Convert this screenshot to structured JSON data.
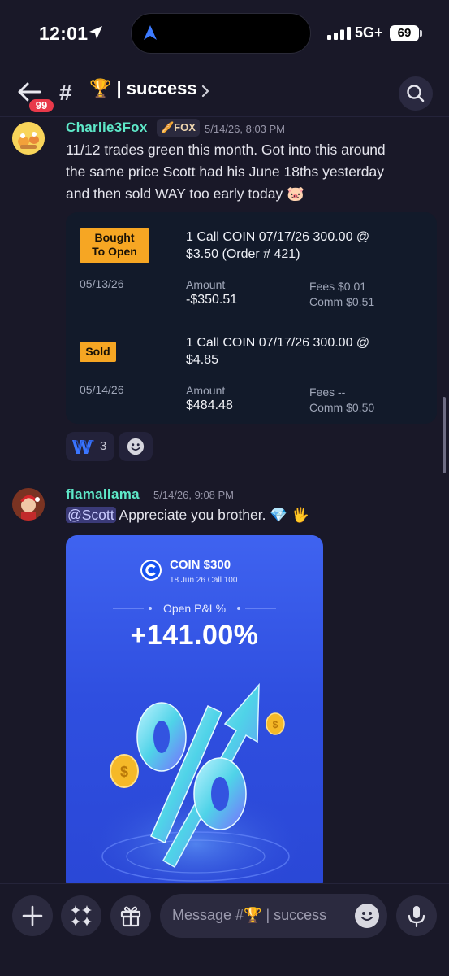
{
  "status_bar": {
    "time": "12:01",
    "network": "5G+",
    "battery": "69"
  },
  "header": {
    "unread_badge": "99",
    "hash": "#",
    "channel_name": "🏆 | success",
    "chevron": "›"
  },
  "messages": [
    {
      "author": "Charlie3Fox",
      "tag": "🥖FOX",
      "timestamp": "5/14/26, 8:03 PM",
      "lines": [
        "11/12 trades green this month. Got into this around",
        "the same price Scott had his June 18ths yesterday",
        "and then sold WAY too early today 🐷"
      ],
      "trades": [
        {
          "action": [
            "Bought",
            "To Open"
          ],
          "date": "05/13/26",
          "desc": [
            "1 Call COIN 07/17/26 300.00 @",
            "$3.50 (Order # 421)"
          ],
          "amount_label": "Amount",
          "amount": "-$350.51",
          "fees": "Fees $0.01",
          "comm": "Comm $0.51"
        },
        {
          "action": [
            "Sold"
          ],
          "date": "05/14/26",
          "desc": [
            "1 Call COIN 07/17/26 300.00 @",
            "$4.85"
          ],
          "amount_label": "Amount",
          "amount": "$484.48",
          "fees": "Fees --",
          "comm": "Comm $0.50"
        }
      ],
      "reaction": {
        "emoji_name": "w-logo",
        "glyph": "W",
        "count": "3"
      }
    },
    {
      "author": "flamallama",
      "timestamp": "5/14/26, 9:08 PM",
      "mention": "@Scott",
      "text": " Appreciate you brother. 💎 🖐",
      "card": {
        "ticker": "COIN $300",
        "subtitle": "18 Jun 26 Call 100",
        "label": "Open P&L%",
        "value": "+141.00%"
      }
    }
  ],
  "composer": {
    "placeholder": "Message #🏆 | success"
  },
  "colors": {
    "background": "#191828",
    "accent_username": "#5ee8c8",
    "pill": "#f6a623",
    "badge": "#e8394a"
  }
}
